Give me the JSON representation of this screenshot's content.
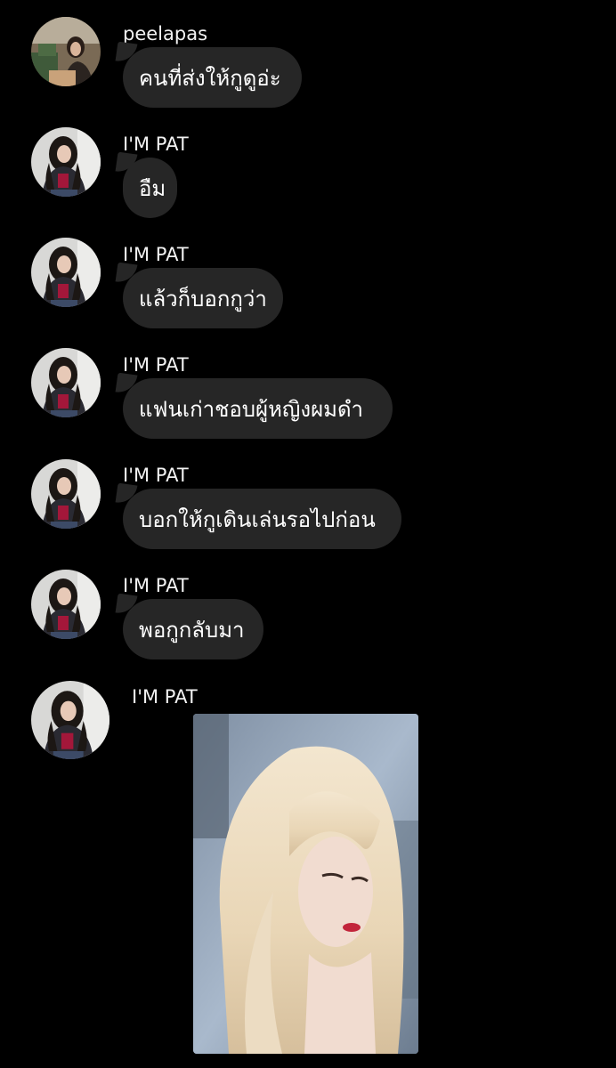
{
  "messages": [
    {
      "sender": "peelapas",
      "text": "คนที่ส่งให้กูดูอ่ะ",
      "avatar": "avatar-peelapas"
    },
    {
      "sender": "I'M PAT",
      "text": "อืม",
      "avatar": "avatar-pat"
    },
    {
      "sender": "I'M PAT",
      "text": "แล้วก็บอกกูว่า",
      "avatar": "avatar-pat"
    },
    {
      "sender": "I'M PAT",
      "text": "แฟนเก่าชอบผู้หญิงผมดำ",
      "avatar": "avatar-pat"
    },
    {
      "sender": "I'M PAT",
      "text": "บอกให้กูเดินเล่นรอไปก่อน",
      "avatar": "avatar-pat"
    },
    {
      "sender": "I'M PAT",
      "text": "พอกูกลับมา",
      "avatar": "avatar-pat"
    },
    {
      "sender": "I'M PAT",
      "image": "photo-blonde-woman",
      "avatar": "avatar-pat"
    }
  ],
  "colors": {
    "background": "#000000",
    "bubble": "#262626",
    "text": "#ffffff"
  }
}
